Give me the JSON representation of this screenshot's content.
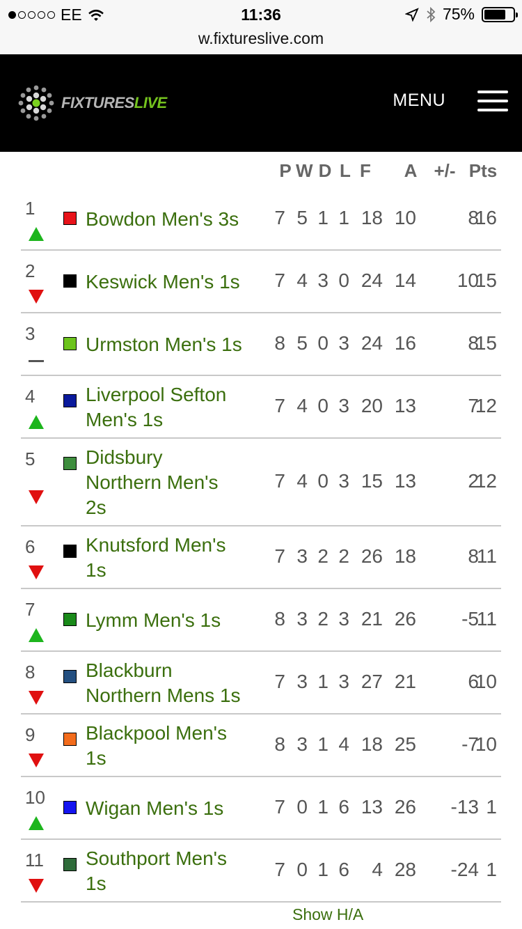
{
  "status_bar": {
    "carrier": "EE",
    "time": "11:36",
    "battery_percent": "75%",
    "battery_level": 0.75
  },
  "browser": {
    "url": "w.fixtureslive.com"
  },
  "header": {
    "logo_part1": "FIXTURES",
    "logo_part2": "LIVE",
    "menu_label": "MENU"
  },
  "table": {
    "columns": [
      "P",
      "W",
      "D",
      "L",
      "F",
      "A",
      "+/-",
      "Pts"
    ],
    "rows": [
      {
        "pos": "1",
        "trend": "up",
        "color": "#e8131a",
        "lines": [
          "Bowdon Men's 3s"
        ],
        "p": "7",
        "w": "5",
        "d": "1",
        "l": "1",
        "f": "18",
        "a": "10",
        "gd": "8",
        "pts": "16"
      },
      {
        "pos": "2",
        "trend": "down",
        "color": "#000000",
        "lines": [
          "Keswick Men's 1s"
        ],
        "p": "7",
        "w": "4",
        "d": "3",
        "l": "0",
        "f": "24",
        "a": "14",
        "gd": "10",
        "pts": "15"
      },
      {
        "pos": "3",
        "trend": "same",
        "color": "#6cc41c",
        "lines": [
          "Urmston Men's 1s"
        ],
        "p": "8",
        "w": "5",
        "d": "0",
        "l": "3",
        "f": "24",
        "a": "16",
        "gd": "8",
        "pts": "15"
      },
      {
        "pos": "4",
        "trend": "up",
        "color": "#0a1a9c",
        "lines": [
          "Liverpool Sefton",
          "Men's 1s"
        ],
        "p": "7",
        "w": "4",
        "d": "0",
        "l": "3",
        "f": "20",
        "a": "13",
        "gd": "7",
        "pts": "12"
      },
      {
        "pos": "5",
        "trend": "down",
        "color": "#3e8e3e",
        "lines": [
          "Didsbury",
          "Northern Men's",
          "2s"
        ],
        "p": "7",
        "w": "4",
        "d": "0",
        "l": "3",
        "f": "15",
        "a": "13",
        "gd": "2",
        "pts": "12"
      },
      {
        "pos": "6",
        "trend": "down",
        "color": "#000000",
        "lines": [
          "Knutsford Men's",
          "1s"
        ],
        "p": "7",
        "w": "3",
        "d": "2",
        "l": "2",
        "f": "26",
        "a": "18",
        "gd": "8",
        "pts": "11"
      },
      {
        "pos": "7",
        "trend": "up",
        "color": "#1a8a1a",
        "lines": [
          "Lymm Men's 1s"
        ],
        "p": "8",
        "w": "3",
        "d": "2",
        "l": "3",
        "f": "21",
        "a": "26",
        "gd": "-5",
        "pts": "11"
      },
      {
        "pos": "8",
        "trend": "down",
        "color": "#234f80",
        "lines": [
          "Blackburn",
          "Northern Mens 1s"
        ],
        "p": "7",
        "w": "3",
        "d": "1",
        "l": "3",
        "f": "27",
        "a": "21",
        "gd": "6",
        "pts": "10"
      },
      {
        "pos": "9",
        "trend": "down",
        "color": "#f36c1c",
        "lines": [
          "Blackpool Men's",
          "1s"
        ],
        "p": "8",
        "w": "3",
        "d": "1",
        "l": "4",
        "f": "18",
        "a": "25",
        "gd": "-7",
        "pts": "10"
      },
      {
        "pos": "10",
        "trend": "up",
        "color": "#1414f0",
        "lines": [
          "Wigan Men's 1s"
        ],
        "p": "7",
        "w": "0",
        "d": "1",
        "l": "6",
        "f": "13",
        "a": "26",
        "gd": "-13",
        "pts": "1"
      },
      {
        "pos": "11",
        "trend": "down",
        "color": "#2f6b3a",
        "lines": [
          "Southport Men's",
          "1s"
        ],
        "p": "7",
        "w": "0",
        "d": "1",
        "l": "6",
        "f": "4",
        "a": "28",
        "gd": "-24",
        "pts": "1"
      }
    ]
  },
  "footer": {
    "show_ha_label": "Show H/A"
  },
  "colors": {
    "team_link": "#3b6f0e",
    "up_arrow": "#1db51d",
    "down_arrow": "#e01010",
    "same_dash": "#555555"
  }
}
